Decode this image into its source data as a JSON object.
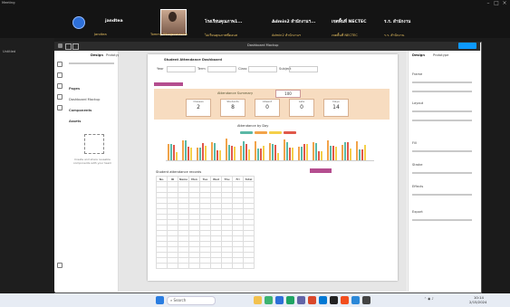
{
  "meeting": {
    "window_title": "Meeting",
    "participants": [
      {
        "name": "jandtea",
        "subtitle": "Jandtea"
      },
      {
        "name": "",
        "subtitle": "Tommy Wongsuwanich"
      },
      {
        "name": "โรงเรียนคุณภาพ1...",
        "subtitle": "ไม่เรียนคุณภาพพี่ดอนส"
      },
      {
        "name": "Admin2 สำนักงานฯ...",
        "subtitle": "Admin2 สำนักงานฯ"
      },
      {
        "name": "เขตพื้นที่ NECTEC",
        "subtitle": "เขตพื้นที่ NECTEC"
      },
      {
        "name": "ร.ร. สำนักงาน",
        "subtitle": "ร.ร. สำนักงาน"
      }
    ],
    "side_label": "Untitled"
  },
  "figma": {
    "file_title": "Dashboard Mockup",
    "left_tabs": [
      "Design",
      "Prototype",
      "Assets"
    ],
    "left_sections": [
      "Pages",
      "Dashboard Mockup",
      "Components",
      "Assets"
    ],
    "empty_state": "Create and share reusable components with your team",
    "right_labels": [
      "Design",
      "Prototype",
      "Frame",
      "Layout",
      "Fill",
      "Stroke",
      "Effects",
      "Export"
    ],
    "zoom": "100%"
  },
  "dashboard": {
    "header": "Student Attendance Dashboard",
    "filter_labels": [
      "Year",
      "Term",
      "Class",
      "Subject"
    ],
    "banner_title": "Attendance Summary",
    "banner_value": "100",
    "stats": [
      {
        "value": "2",
        "label": "Classes"
      },
      {
        "value": "8",
        "label": "Students"
      },
      {
        "value": "0",
        "label": "Absent"
      },
      {
        "value": "0",
        "label": "Late"
      },
      {
        "value": "14",
        "label": "Days"
      }
    ],
    "chart_title": "Attendance by Day",
    "legend": [
      {
        "name": "Present",
        "color": "#f2a34a"
      },
      {
        "name": "Late",
        "color": "#5bb8a6"
      },
      {
        "name": "Absent",
        "color": "#e0584a"
      },
      {
        "name": "Leave",
        "color": "#f5d04a"
      }
    ],
    "table_title": "Student attendance records",
    "table_button": "Export",
    "table_headers": [
      "No.",
      "ID",
      "Name",
      "Mon",
      "Tue",
      "Wed",
      "Thu",
      "Fri",
      "Total"
    ]
  },
  "taskbar": {
    "search_placeholder": "Search",
    "time": "10:14",
    "date": "2/15/2024"
  },
  "colors": {
    "accent": "#b44d8f",
    "banner": "#f7dcc0"
  }
}
